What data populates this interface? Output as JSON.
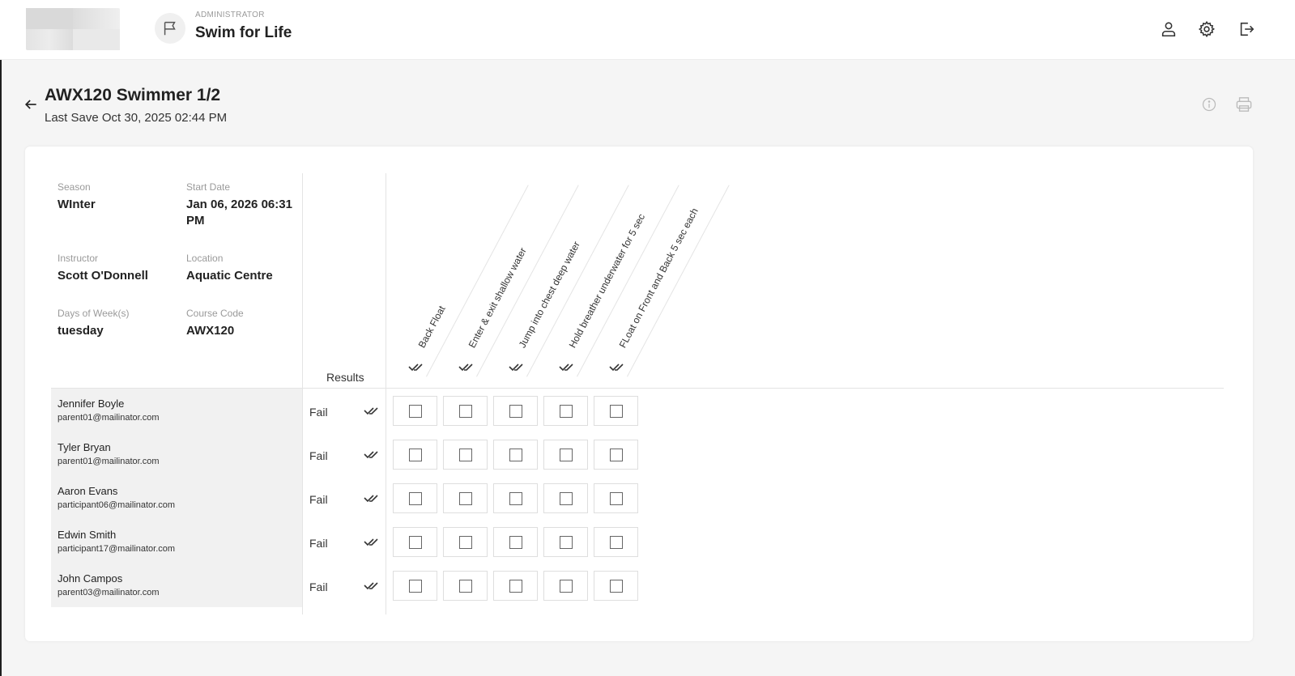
{
  "header": {
    "role": "ADMINISTRATOR",
    "app_title": "Swim for Life",
    "icons": [
      "user-icon",
      "gear-icon",
      "logout-icon"
    ]
  },
  "page": {
    "title": "AWX120 Swimmer 1/2",
    "last_save": "Last Save Oct 30, 2025 02:44 PM"
  },
  "course": {
    "season_label": "Season",
    "season": "WInter",
    "start_date_label": "Start Date",
    "start_date": "Jan 06, 2026 06:31 PM",
    "instructor_label": "Instructor",
    "instructor": "Scott O'Donnell",
    "location_label": "Location",
    "location": "Aquatic Centre",
    "days_label": "Days of Week(s)",
    "days": "tuesday",
    "course_code_label": "Course Code",
    "course_code": "AWX120"
  },
  "results_label": "Results",
  "skills": [
    "Back Float",
    "Enter & exit shallow water",
    "Jump into chest deep water",
    "Hold breather underwater for 5 sec",
    "FLoat on Front and Back 5 sec each"
  ],
  "swimmers": [
    {
      "name": "Jennifer Boyle",
      "email": "parent01@mailinator.com",
      "result": "Fail"
    },
    {
      "name": "Tyler Bryan",
      "email": "parent01@mailinator.com",
      "result": "Fail"
    },
    {
      "name": "Aaron Evans",
      "email": "participant06@mailinator.com",
      "result": "Fail"
    },
    {
      "name": "Edwin Smith",
      "email": "participant17@mailinator.com",
      "result": "Fail"
    },
    {
      "name": "John Campos",
      "email": "parent03@mailinator.com",
      "result": "Fail"
    }
  ]
}
